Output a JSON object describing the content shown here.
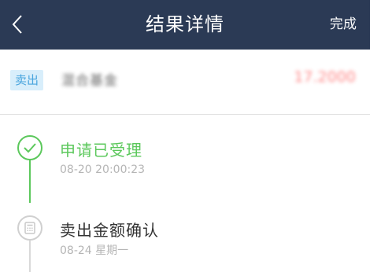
{
  "header": {
    "title": "结果详情",
    "done_label": "完成"
  },
  "summary": {
    "tag": "卖出",
    "fund_name": "混合基金",
    "amount": "17.2000"
  },
  "steps": [
    {
      "title": "申请已受理",
      "date": "08-20 20:00:23",
      "status": "completed"
    },
    {
      "title": "卖出金额确认",
      "date": "08-24 星期一",
      "status": "pending"
    }
  ],
  "colors": {
    "header_bg": "#2b3a55",
    "accent_green": "#5cc85c",
    "tag_bg": "#d8eefb",
    "tag_text": "#4aa5de",
    "amount_red": "#ff7b7b"
  },
  "icons": [
    "back-icon",
    "check-icon",
    "calculator-icon"
  ]
}
